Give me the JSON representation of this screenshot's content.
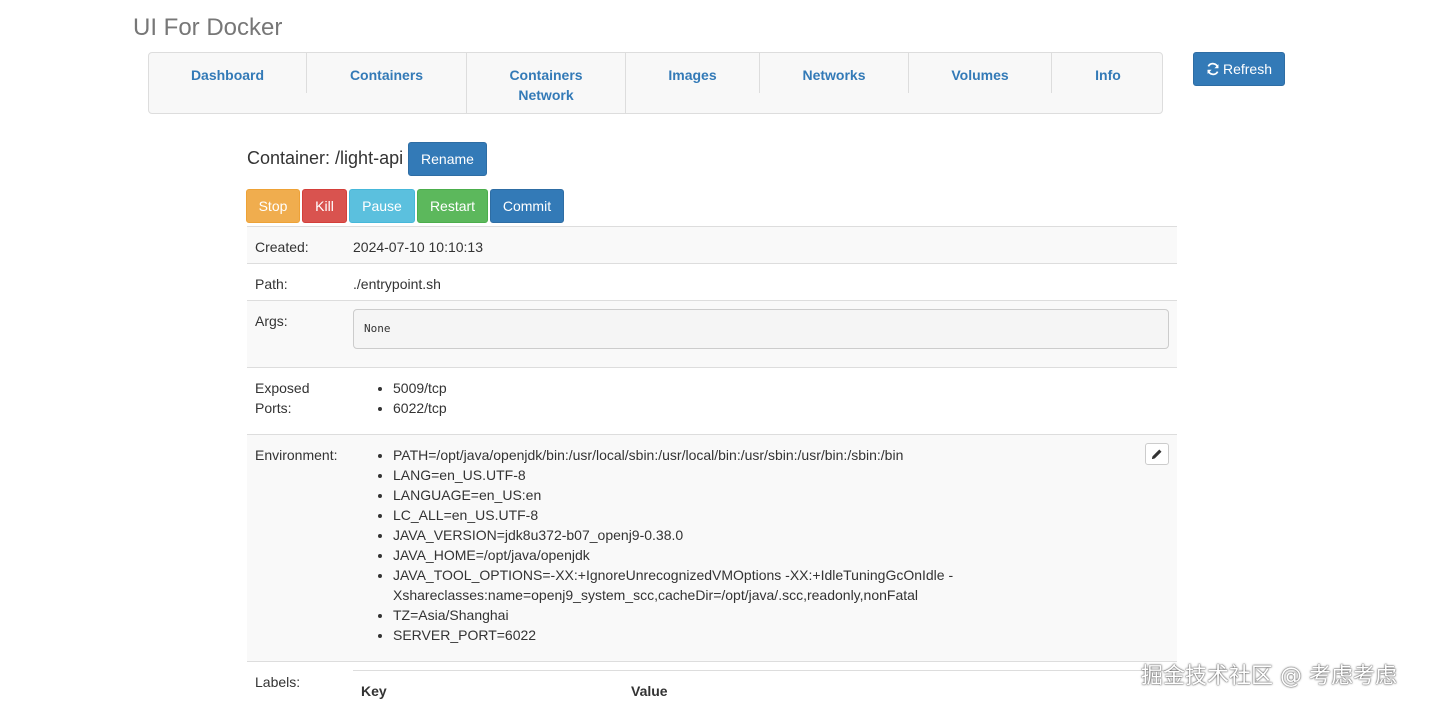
{
  "app": {
    "title": "UI For Docker"
  },
  "nav": {
    "tabs": [
      {
        "label": "Dashboard"
      },
      {
        "label": "Containers"
      },
      {
        "label": "Containers Network"
      },
      {
        "label": "Images"
      },
      {
        "label": "Networks"
      },
      {
        "label": "Volumes"
      },
      {
        "label": "Info"
      }
    ],
    "refresh_label": "Refresh"
  },
  "container": {
    "title": "Container: /light-api",
    "rename_label": "Rename",
    "actions": {
      "stop": "Stop",
      "kill": "Kill",
      "pause": "Pause",
      "restart": "Restart",
      "commit": "Commit"
    },
    "details": {
      "created_label": "Created:",
      "created_value": "2024-07-10 10:10:13",
      "path_label": "Path:",
      "path_value": "./entrypoint.sh",
      "args_label": "Args:",
      "args_value": "None",
      "ports_label_line1": "Exposed",
      "ports_label_line2": "Ports:",
      "ports": [
        "5009/tcp",
        "6022/tcp"
      ],
      "env_label": "Environment:",
      "env": [
        "PATH=/opt/java/openjdk/bin:/usr/local/sbin:/usr/local/bin:/usr/sbin:/usr/bin:/sbin:/bin",
        "LANG=en_US.UTF-8",
        "LANGUAGE=en_US:en",
        "LC_ALL=en_US.UTF-8",
        "JAVA_VERSION=jdk8u372-b07_openj9-0.38.0",
        "JAVA_HOME=/opt/java/openjdk",
        "JAVA_TOOL_OPTIONS=-XX:+IgnoreUnrecognizedVMOptions -XX:+IdleTuningGcOnIdle -Xshareclasses:name=openj9_system_scc,cacheDir=/opt/java/.scc,readonly,nonFatal",
        "TZ=Asia/Shanghai",
        "SERVER_PORT=6022"
      ],
      "labels_label": "Labels:",
      "labels_key_header": "Key",
      "labels_value_header": "Value"
    }
  },
  "watermark": "掘金技术社区 @ 考虑考虑",
  "colors": {
    "primary": "#337ab7",
    "warning": "#f0ad4e",
    "danger": "#d9534f",
    "info": "#5bc0de",
    "success": "#5cb85c"
  },
  "icons": {
    "refresh": "refresh-icon",
    "edit": "pencil-icon"
  }
}
